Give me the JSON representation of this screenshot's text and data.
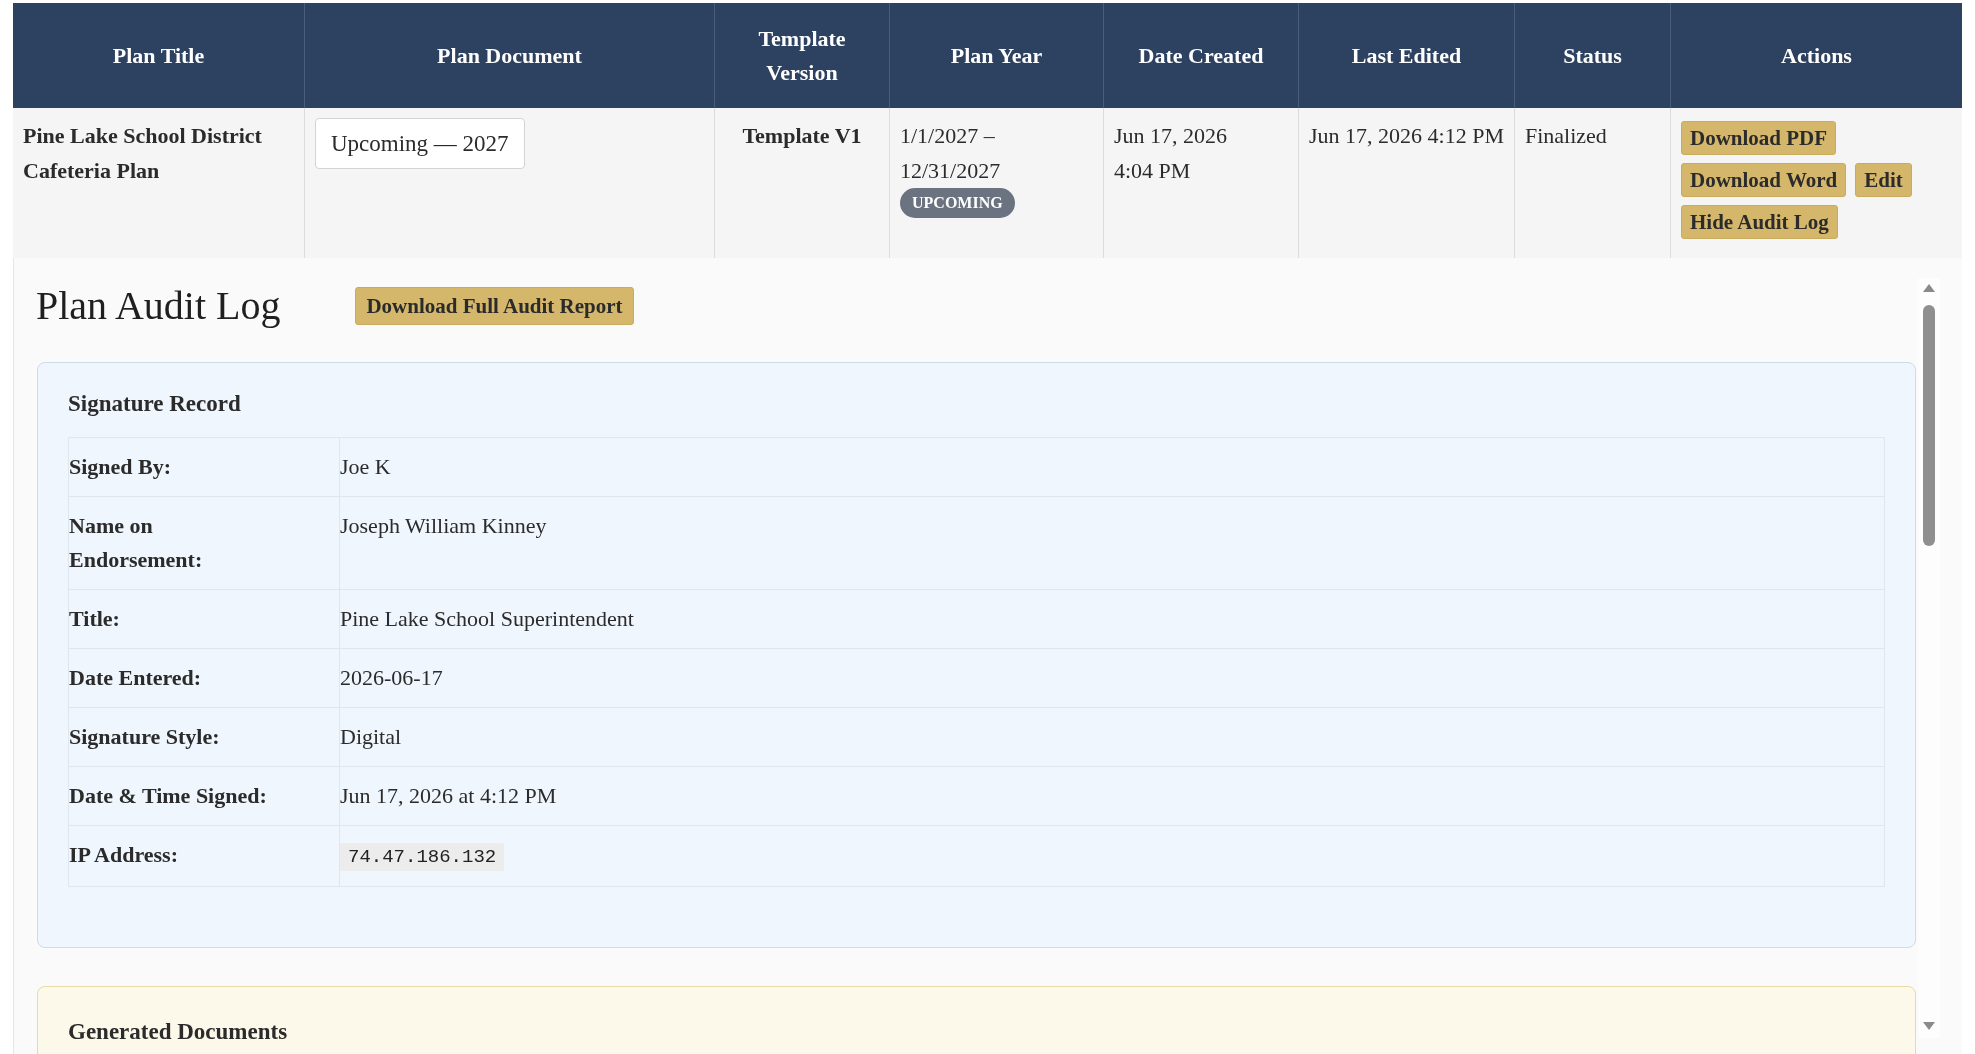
{
  "table": {
    "columns": [
      "Plan Title",
      "Plan Document",
      "Template Version",
      "Plan Year",
      "Date Created",
      "Last Edited",
      "Status",
      "Actions"
    ],
    "rows": [
      {
        "plan_title": "Pine Lake School District Cafeteria Plan",
        "plan_document": "Upcoming — 2027",
        "template_version": "Template V1",
        "plan_year": "1/1/2027 – 12/31/2027",
        "plan_year_badge": "UPCOMING",
        "date_created": "Jun 17, 2026 4:04 PM",
        "last_edited": "Jun 17, 2026 4:12 PM",
        "status": "Finalized",
        "actions": [
          "Download PDF",
          "Download Word",
          "Edit",
          "Hide Audit Log"
        ]
      }
    ]
  },
  "audit_log": {
    "title": "Plan Audit Log",
    "report_button": "Download Full Audit Report",
    "signature_record": {
      "title": "Signature Record",
      "fields": [
        {
          "label": "Signed By:",
          "value": "Joe K",
          "kind": "text"
        },
        {
          "label": "Name on Endorsement:",
          "value": "Joseph William Kinney",
          "kind": "text"
        },
        {
          "label": "Title:",
          "value": "Pine Lake School Superintendent",
          "kind": "text"
        },
        {
          "label": "Date Entered:",
          "value": "2026-06-17",
          "kind": "text"
        },
        {
          "label": "Signature Style:",
          "value": "Digital",
          "kind": "text"
        },
        {
          "label": "Date & Time Signed:",
          "value": "Jun 17, 2026 at 4:12 PM",
          "kind": "text"
        },
        {
          "label": "IP Address:",
          "value": "74.47.186.132",
          "kind": "code"
        }
      ]
    },
    "generated_documents": {
      "title": "Generated Documents"
    }
  }
}
